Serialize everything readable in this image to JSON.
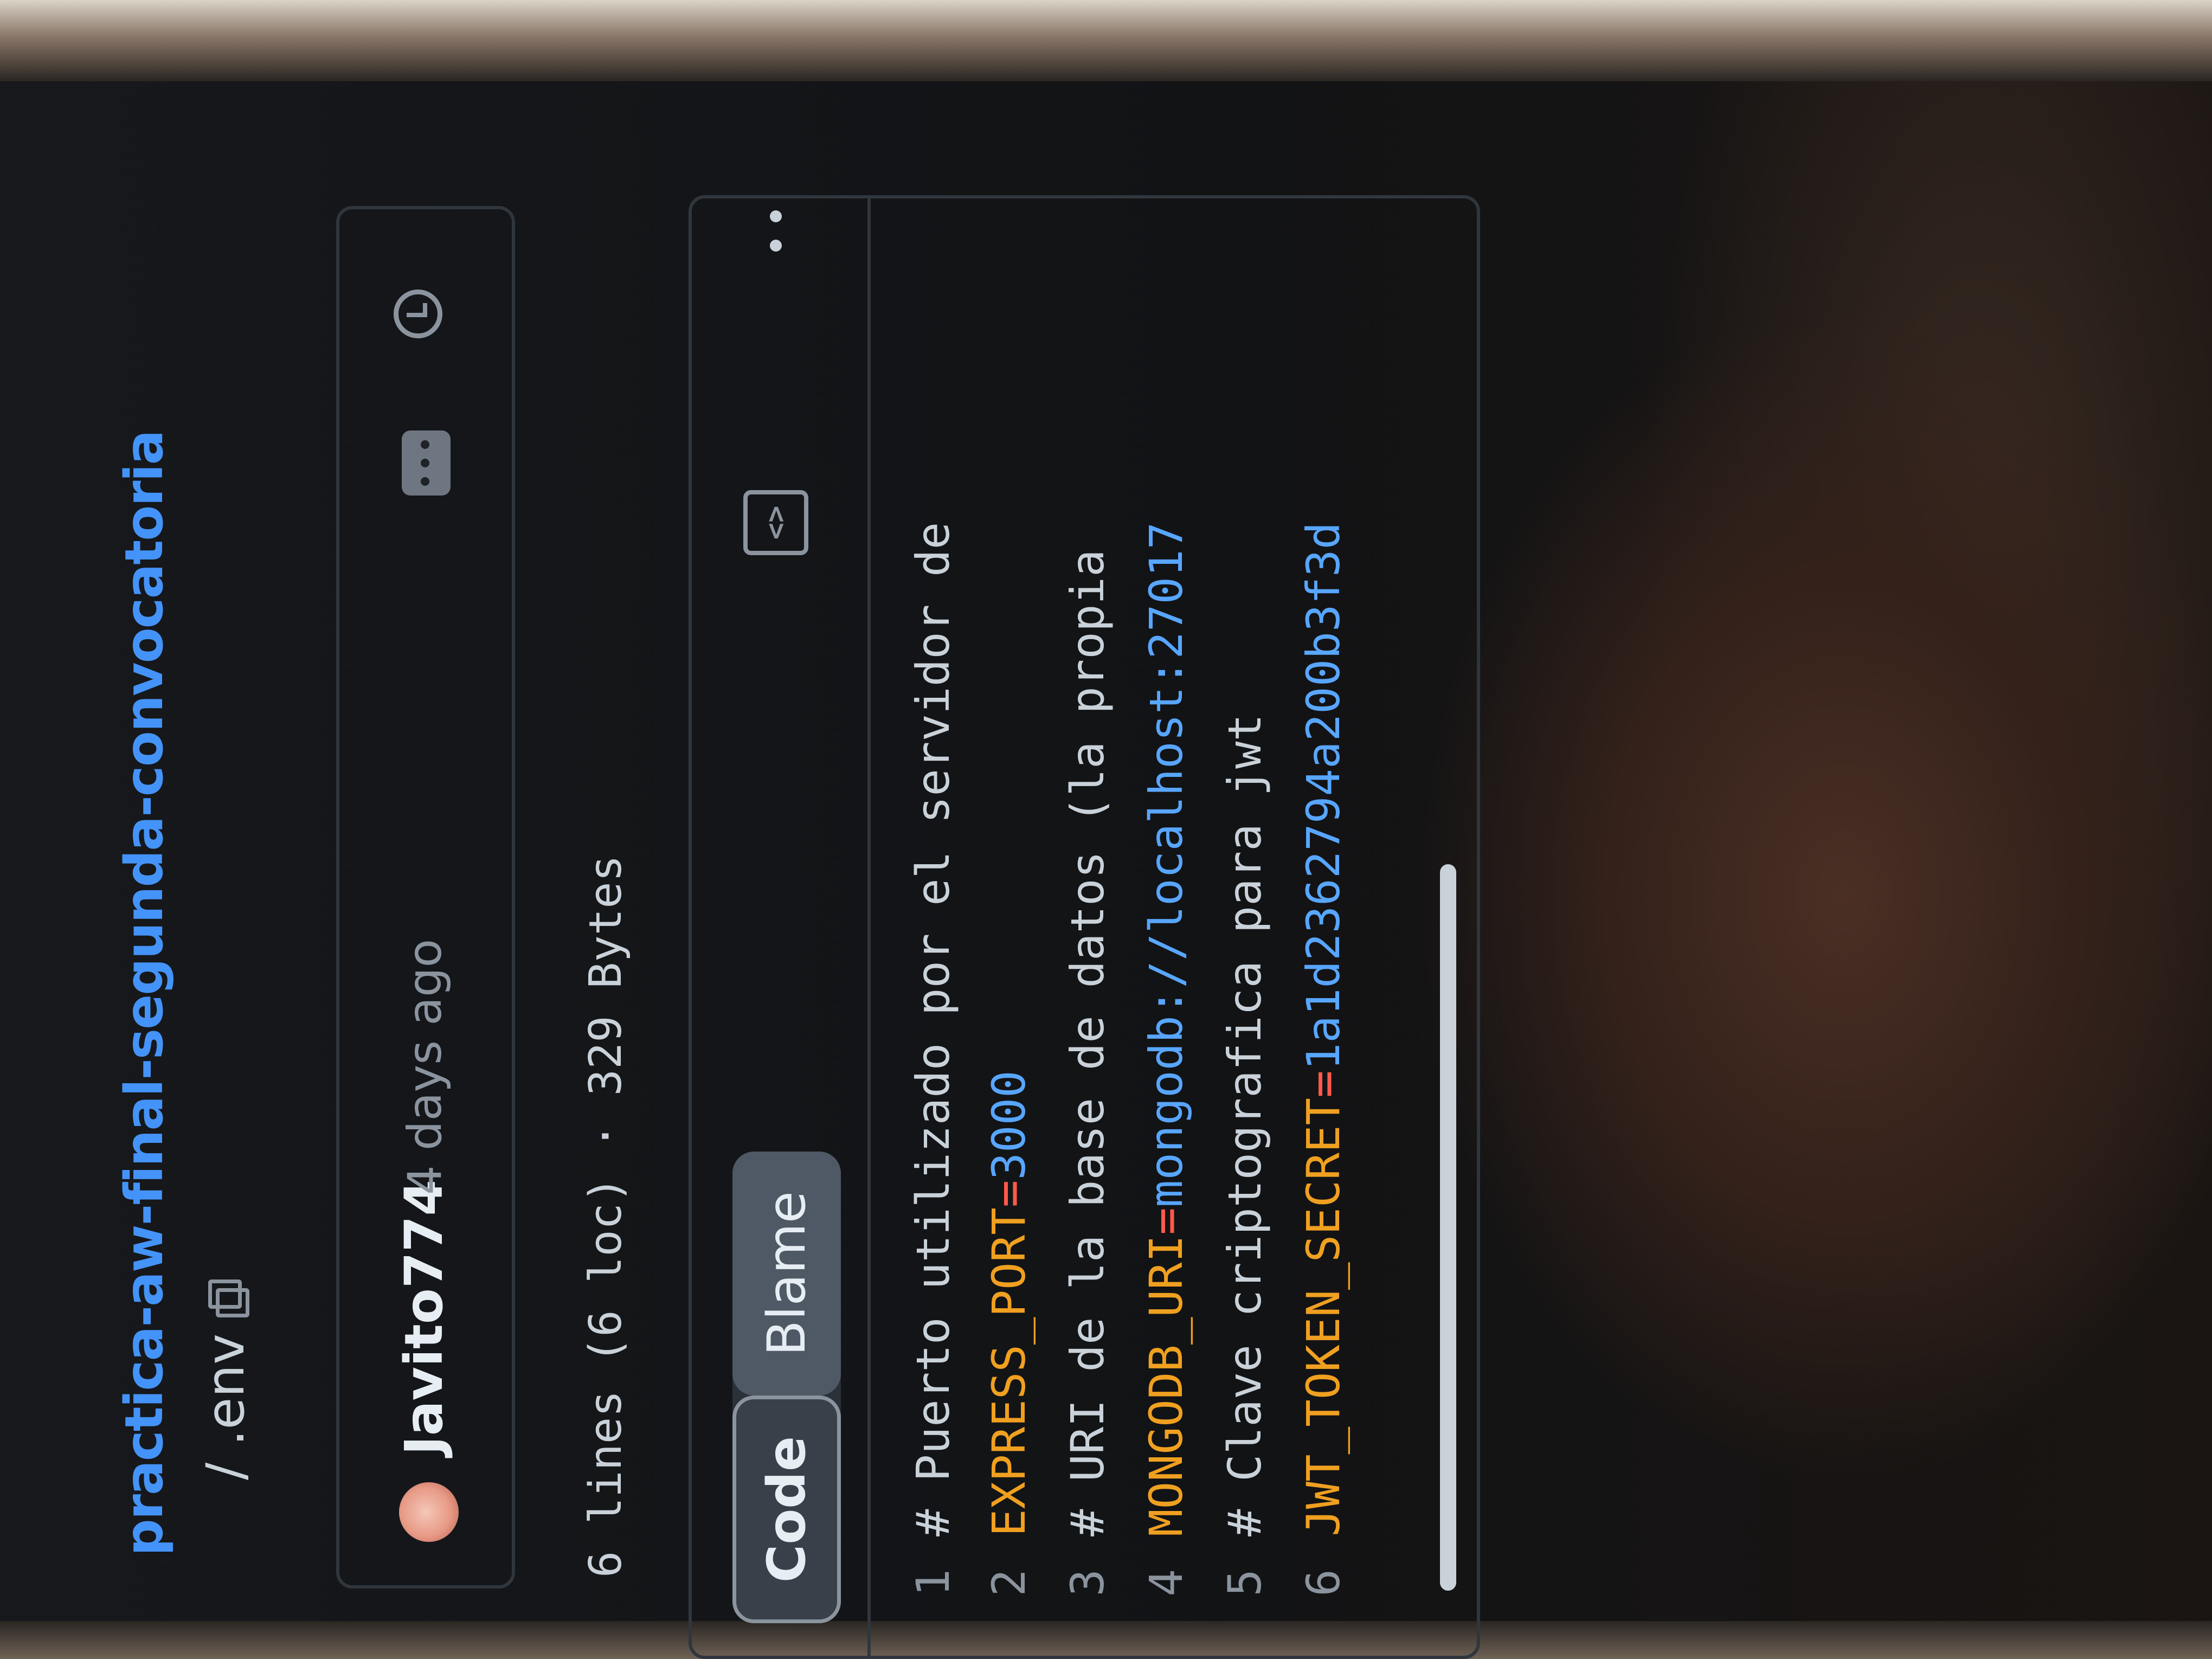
{
  "repo": {
    "name": "practica-aw-final-segunda-convocatoria",
    "path": "/ .env"
  },
  "commit": {
    "author": "Javito774",
    "time": "4 days ago"
  },
  "file": {
    "info": "6 lines (6 loc) · 329 Bytes"
  },
  "view_modes": {
    "code_label": "Code",
    "blame_label": "Blame",
    "active": "Code"
  },
  "icons": {
    "copy": "copy-icon",
    "history": "history-icon",
    "more": "more-dots-icon",
    "raw": "code-square-icon",
    "kebab": "kebab-menu-icon"
  },
  "code": {
    "lines": [
      {
        "num": "1",
        "comment": "# Puerto utilizado por el servidor de"
      },
      {
        "num": "2",
        "key": "EXPRESS_PORT",
        "eq": "=",
        "value": "3000"
      },
      {
        "num": "3",
        "comment": "# URI de la base de datos (la propia"
      },
      {
        "num": "4",
        "key": "MONGODB_URI",
        "eq": "=",
        "value": "mongodb://localhost:27017"
      },
      {
        "num": "5",
        "comment": "# Clave criptografica para jwt"
      },
      {
        "num": "6",
        "key": "JWT_TOKEN_SECRET",
        "eq": "=",
        "value": "1a1d2362794a200b3f3d"
      }
    ]
  },
  "colors": {
    "link": "#4493f8",
    "key": "#f0a020",
    "equals": "#ff5a4a",
    "value": "#58a6ff"
  }
}
